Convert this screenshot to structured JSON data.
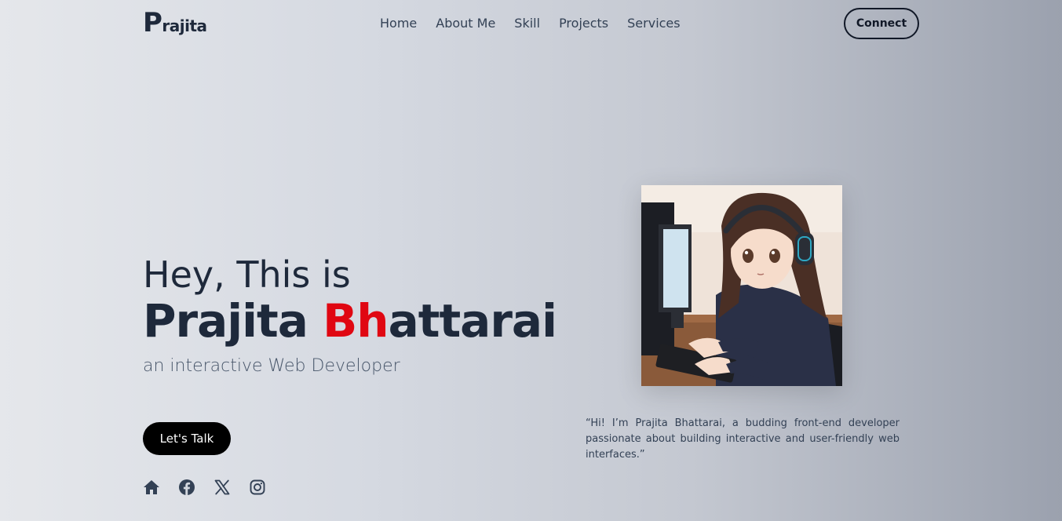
{
  "brand": {
    "initial": "P",
    "rest": "rajita"
  },
  "nav": {
    "items": [
      {
        "label": "Home"
      },
      {
        "label": "About Me"
      },
      {
        "label": "Skill"
      },
      {
        "label": "Projects"
      },
      {
        "label": "Services"
      }
    ],
    "connect_label": "Connect"
  },
  "hero": {
    "greeting": "Hey, This is",
    "first_name": "Prajita",
    "last_name_accent": "Bh",
    "last_name_rest": "attarai",
    "tagline": "an interactive Web Developer",
    "cta_label": "Let's Talk",
    "accent_color": "#e00712",
    "socials": [
      {
        "icon": "home-icon"
      },
      {
        "icon": "facebook-icon"
      },
      {
        "icon": "x-twitter-icon"
      },
      {
        "icon": "instagram-icon"
      }
    ]
  },
  "about": {
    "quote": "“Hi! I’m Prajita Bhattarai, a budding front-end developer passionate about building interactive and user-friendly web interfaces.”"
  }
}
